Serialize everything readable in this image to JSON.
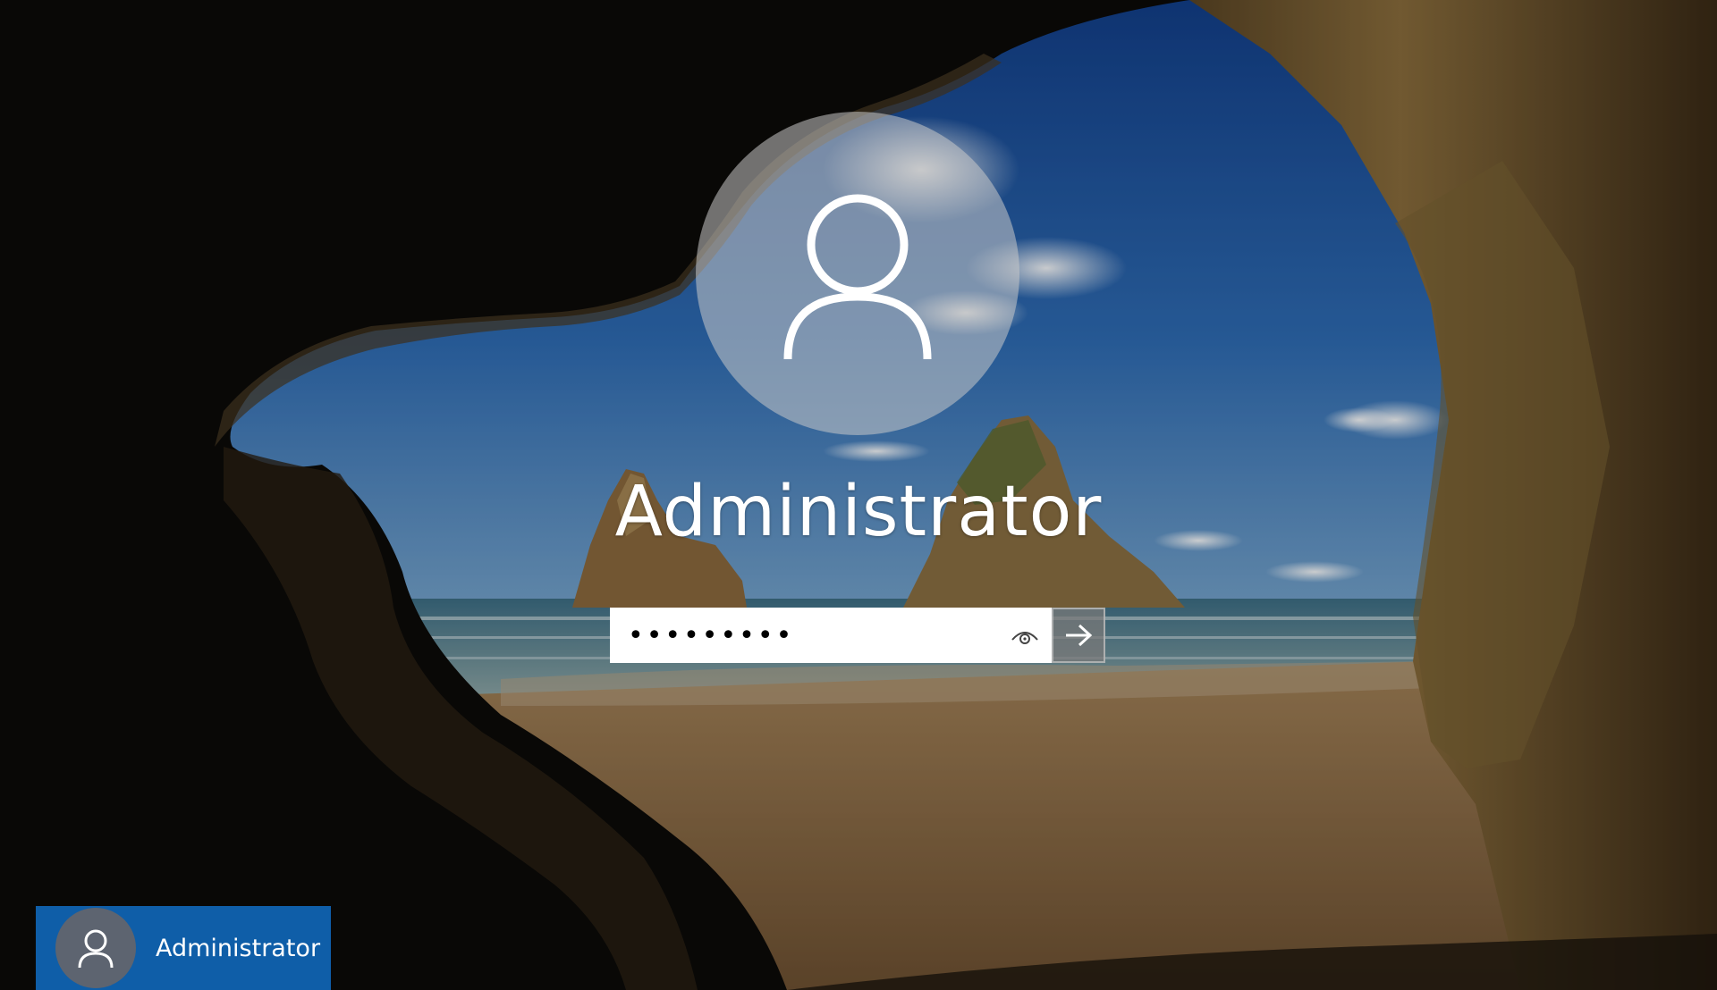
{
  "login": {
    "username": "Administrator",
    "password_mask": "•••••••••",
    "password_length": 9
  },
  "icons": {
    "profile": "user-icon",
    "reveal": "eye-icon",
    "submit": "arrow-right-icon"
  },
  "user_list": [
    {
      "name": "Administrator",
      "selected": true
    }
  ],
  "colors": {
    "selected_tile": "#0f5ea8",
    "avatar_bg": "#c8c8c8",
    "submit_bg": "#787878"
  }
}
